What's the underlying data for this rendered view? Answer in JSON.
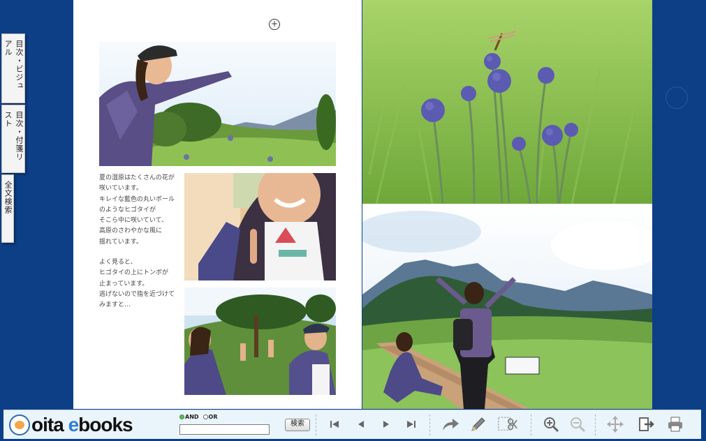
{
  "side_tabs": [
    {
      "label": "目次・ビジュアル"
    },
    {
      "label": "目次・付箋リスト"
    },
    {
      "label": "全文検索"
    }
  ],
  "page_left": {
    "paragraph1": "夏の湿原はたくさんの花が\n咲いています。\nキレイな藍色の丸いボール\nのようなヒゴタイが\nそこら中に咲いていて、\n高原のさわやかな風に\n揺れています。",
    "paragraph2": "よく見ると、\nヒゴタイの上にトンボが\n止まっています。\n逃げないので指を近づけて\nみますと…"
  },
  "toolbar": {
    "logo_prefix": "oita ",
    "logo_e": "e",
    "logo_suffix": "books",
    "radio_and": "AND",
    "radio_or": "OR",
    "search_value": "",
    "search_button": "検索",
    "tools": [
      "first-page-icon",
      "prev-page-icon",
      "next-page-icon",
      "last-page-icon",
      "share-arrow-icon",
      "pencil-icon",
      "clip-scissors-icon",
      "zoom-in-icon",
      "zoom-out-icon",
      "move-icon",
      "export-icon",
      "print-icon"
    ]
  },
  "colors": {
    "background": "#0d3f86",
    "toolbar": "#eaf4fb",
    "logo_accent": "#2f7fd6"
  }
}
